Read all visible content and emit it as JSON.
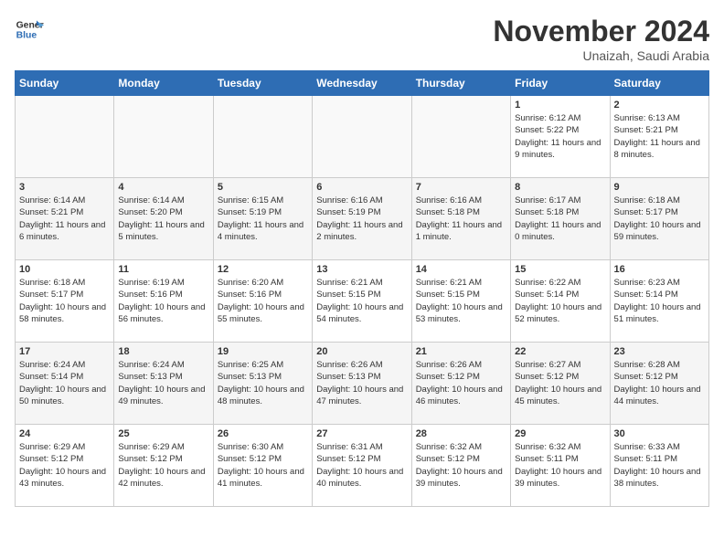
{
  "logo": {
    "line1": "General",
    "line2": "Blue"
  },
  "title": "November 2024",
  "subtitle": "Unaizah, Saudi Arabia",
  "days_of_week": [
    "Sunday",
    "Monday",
    "Tuesday",
    "Wednesday",
    "Thursday",
    "Friday",
    "Saturday"
  ],
  "weeks": [
    [
      {
        "day": "",
        "info": ""
      },
      {
        "day": "",
        "info": ""
      },
      {
        "day": "",
        "info": ""
      },
      {
        "day": "",
        "info": ""
      },
      {
        "day": "",
        "info": ""
      },
      {
        "day": "1",
        "info": "Sunrise: 6:12 AM\nSunset: 5:22 PM\nDaylight: 11 hours and 9 minutes."
      },
      {
        "day": "2",
        "info": "Sunrise: 6:13 AM\nSunset: 5:21 PM\nDaylight: 11 hours and 8 minutes."
      }
    ],
    [
      {
        "day": "3",
        "info": "Sunrise: 6:14 AM\nSunset: 5:21 PM\nDaylight: 11 hours and 6 minutes."
      },
      {
        "day": "4",
        "info": "Sunrise: 6:14 AM\nSunset: 5:20 PM\nDaylight: 11 hours and 5 minutes."
      },
      {
        "day": "5",
        "info": "Sunrise: 6:15 AM\nSunset: 5:19 PM\nDaylight: 11 hours and 4 minutes."
      },
      {
        "day": "6",
        "info": "Sunrise: 6:16 AM\nSunset: 5:19 PM\nDaylight: 11 hours and 2 minutes."
      },
      {
        "day": "7",
        "info": "Sunrise: 6:16 AM\nSunset: 5:18 PM\nDaylight: 11 hours and 1 minute."
      },
      {
        "day": "8",
        "info": "Sunrise: 6:17 AM\nSunset: 5:18 PM\nDaylight: 11 hours and 0 minutes."
      },
      {
        "day": "9",
        "info": "Sunrise: 6:18 AM\nSunset: 5:17 PM\nDaylight: 10 hours and 59 minutes."
      }
    ],
    [
      {
        "day": "10",
        "info": "Sunrise: 6:18 AM\nSunset: 5:17 PM\nDaylight: 10 hours and 58 minutes."
      },
      {
        "day": "11",
        "info": "Sunrise: 6:19 AM\nSunset: 5:16 PM\nDaylight: 10 hours and 56 minutes."
      },
      {
        "day": "12",
        "info": "Sunrise: 6:20 AM\nSunset: 5:16 PM\nDaylight: 10 hours and 55 minutes."
      },
      {
        "day": "13",
        "info": "Sunrise: 6:21 AM\nSunset: 5:15 PM\nDaylight: 10 hours and 54 minutes."
      },
      {
        "day": "14",
        "info": "Sunrise: 6:21 AM\nSunset: 5:15 PM\nDaylight: 10 hours and 53 minutes."
      },
      {
        "day": "15",
        "info": "Sunrise: 6:22 AM\nSunset: 5:14 PM\nDaylight: 10 hours and 52 minutes."
      },
      {
        "day": "16",
        "info": "Sunrise: 6:23 AM\nSunset: 5:14 PM\nDaylight: 10 hours and 51 minutes."
      }
    ],
    [
      {
        "day": "17",
        "info": "Sunrise: 6:24 AM\nSunset: 5:14 PM\nDaylight: 10 hours and 50 minutes."
      },
      {
        "day": "18",
        "info": "Sunrise: 6:24 AM\nSunset: 5:13 PM\nDaylight: 10 hours and 49 minutes."
      },
      {
        "day": "19",
        "info": "Sunrise: 6:25 AM\nSunset: 5:13 PM\nDaylight: 10 hours and 48 minutes."
      },
      {
        "day": "20",
        "info": "Sunrise: 6:26 AM\nSunset: 5:13 PM\nDaylight: 10 hours and 47 minutes."
      },
      {
        "day": "21",
        "info": "Sunrise: 6:26 AM\nSunset: 5:12 PM\nDaylight: 10 hours and 46 minutes."
      },
      {
        "day": "22",
        "info": "Sunrise: 6:27 AM\nSunset: 5:12 PM\nDaylight: 10 hours and 45 minutes."
      },
      {
        "day": "23",
        "info": "Sunrise: 6:28 AM\nSunset: 5:12 PM\nDaylight: 10 hours and 44 minutes."
      }
    ],
    [
      {
        "day": "24",
        "info": "Sunrise: 6:29 AM\nSunset: 5:12 PM\nDaylight: 10 hours and 43 minutes."
      },
      {
        "day": "25",
        "info": "Sunrise: 6:29 AM\nSunset: 5:12 PM\nDaylight: 10 hours and 42 minutes."
      },
      {
        "day": "26",
        "info": "Sunrise: 6:30 AM\nSunset: 5:12 PM\nDaylight: 10 hours and 41 minutes."
      },
      {
        "day": "27",
        "info": "Sunrise: 6:31 AM\nSunset: 5:12 PM\nDaylight: 10 hours and 40 minutes."
      },
      {
        "day": "28",
        "info": "Sunrise: 6:32 AM\nSunset: 5:12 PM\nDaylight: 10 hours and 39 minutes."
      },
      {
        "day": "29",
        "info": "Sunrise: 6:32 AM\nSunset: 5:11 PM\nDaylight: 10 hours and 39 minutes."
      },
      {
        "day": "30",
        "info": "Sunrise: 6:33 AM\nSunset: 5:11 PM\nDaylight: 10 hours and 38 minutes."
      }
    ]
  ]
}
